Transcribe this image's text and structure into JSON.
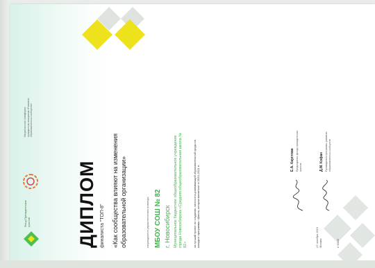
{
  "diploma": {
    "logo_text": "Фонд Президентских грантов",
    "partner_note": "Национальная платформа гражданских инициатив «Развитие образовательных сообществ»",
    "title": "ДИПЛОМ",
    "subtitle": "финалиста \"ТОП-8\"",
    "topic": "«Как сообщества влияют на изменения образовательной организации»",
    "label_small": "награждается управленческая команда",
    "org": "МБОУ СОШ № 82",
    "city": "г. Новосибирск",
    "org_full": "Муниципальное бюджетное общеобразовательное учреждение города Новосибирска «Средняя общеобразовательная школа № 82»",
    "description": "за лучший проект по созданию личностно-развивающей образовательной среды на конкурсе программы «Школа, которая меняется» в 2020–2021 гг.",
    "date": "17 октября 2021 Москва",
    "code": "# 001/6",
    "signer1_name": "Е.А. Каустова",
    "signer1_title": "Председатель фонда президентских грантов",
    "signer2_name": "Д.М. Кофан",
    "signer2_title": "Руководитель программы развития образовательных сообществ",
    "colors": {
      "accent_yellow": "#ede21b",
      "accent_green": "#3fb24a",
      "diamond_gray": "#dfe3e0"
    }
  }
}
